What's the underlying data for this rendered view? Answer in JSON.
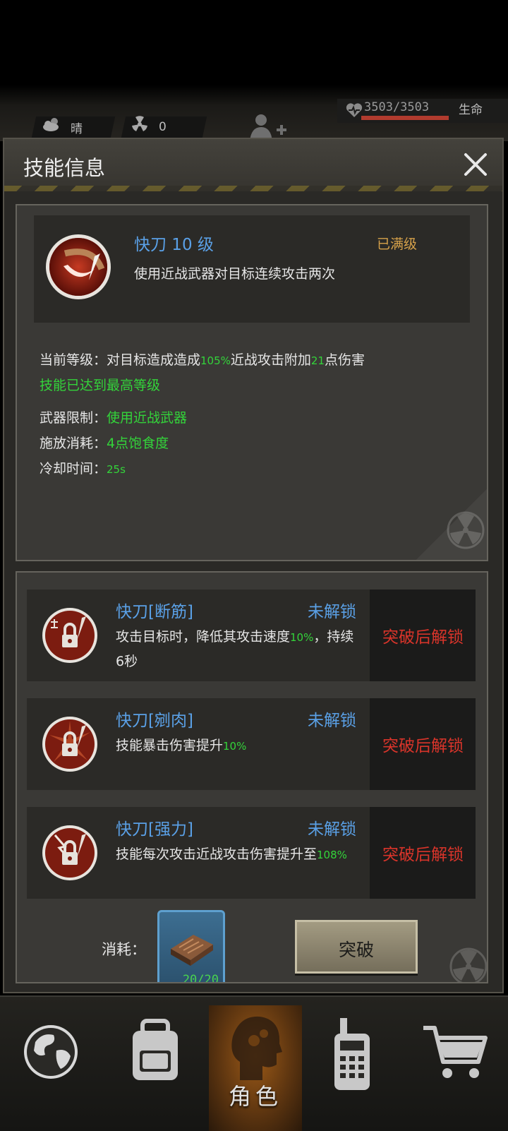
{
  "status_bar": {
    "weather": "晴",
    "radiation": "0",
    "hp": "3503/3503",
    "hp_fraction": 1.0,
    "hp_label": "生命"
  },
  "dialog": {
    "title": "技能信息"
  },
  "skill": {
    "name": "快刀 10 级",
    "max_level_badge": "已满级",
    "description": "使用近战武器对目标连续攻击两次",
    "current_level_prefix": "当前等级：对目标造成造成",
    "current_level_pct": "105%",
    "current_level_mid": "近战攻击附加",
    "current_level_bonus": "21",
    "current_level_suffix": "点伤害",
    "max_reached": "技能已达到最高等级",
    "weapon_label": "武器限制：",
    "weapon_value": "使用近战武器",
    "cost_label": "施放消耗：",
    "cost_value": "4点饱食度",
    "cooldown_label": "冷却时间：",
    "cooldown_value": "25s"
  },
  "sub_skills": [
    {
      "name": "快刀[断筋]",
      "status": "未解锁",
      "desc_prefix": "攻击目标时，降低其攻击速度",
      "desc_value": "10%",
      "desc_suffix": "，持续6秒",
      "lock_text": "突破后解锁"
    },
    {
      "name": "快刀[剜肉]",
      "status": "未解锁",
      "desc_prefix": "技能暴击伤害提升",
      "desc_value": "10%",
      "desc_suffix": "",
      "lock_text": "突破后解锁"
    },
    {
      "name": "快刀[强力]",
      "status": "未解锁",
      "desc_prefix": "技能每次攻击近战攻击伤害提升至",
      "desc_value": "108%",
      "desc_suffix": "",
      "lock_text": "突破后解锁"
    }
  ],
  "breakthrough": {
    "cost_label": "消耗：",
    "item_count": "20/20",
    "button_label": "突破"
  },
  "bottom_nav": {
    "active_label": "角色"
  },
  "colors": {
    "skill_blue": "#5aa0e6",
    "value_green": "#33d43a",
    "lock_red": "#d8342a",
    "maxed_gold": "#d6a14a"
  }
}
